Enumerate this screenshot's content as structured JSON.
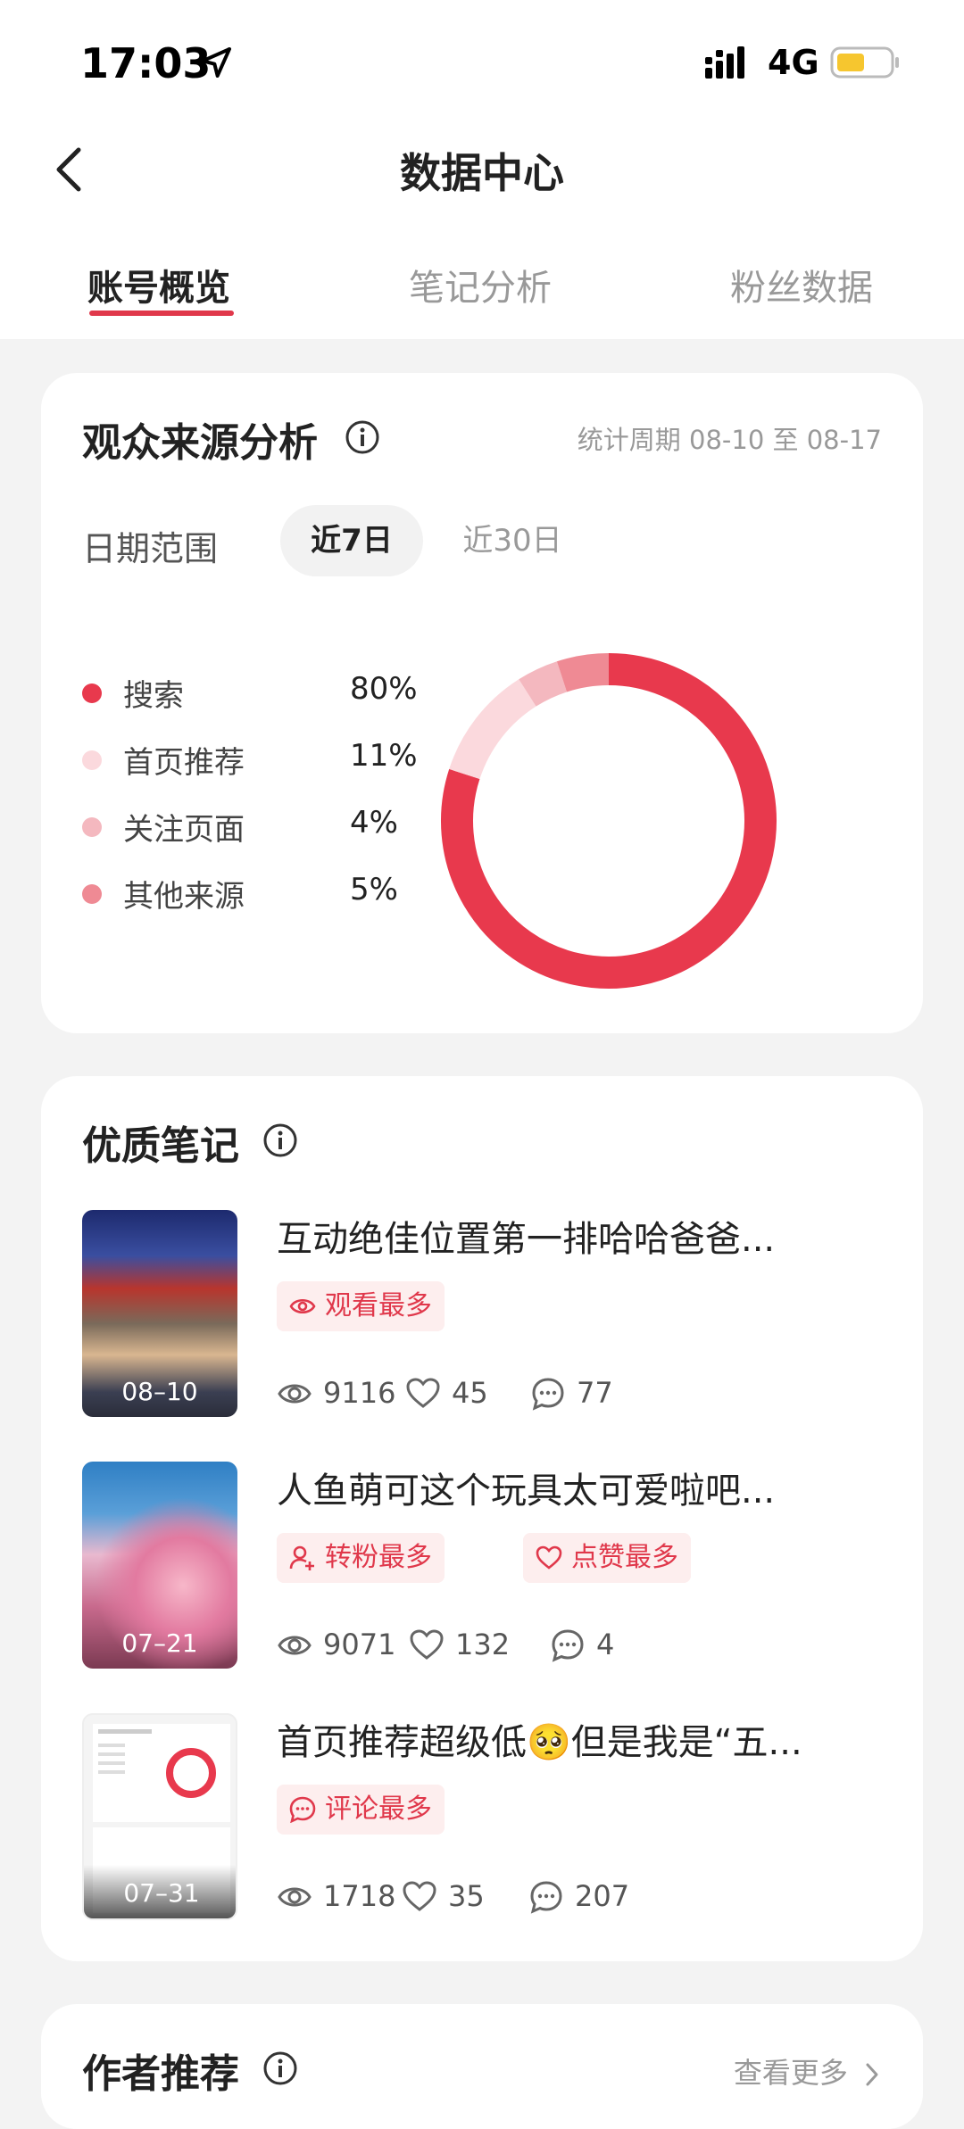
{
  "status_bar": {
    "time": "17:03",
    "network": "4G"
  },
  "nav": {
    "title": "数据中心"
  },
  "tabs": [
    {
      "label": "账号概览",
      "active": true
    },
    {
      "label": "笔记分析",
      "active": false
    },
    {
      "label": "粉丝数据",
      "active": false
    }
  ],
  "audience": {
    "title": "观众来源分析",
    "period": "统计周期 08-10 至 08-17",
    "range_label": "日期范围",
    "range_options": [
      "近7日",
      "近30日"
    ],
    "selected_range": "近7日",
    "legend": [
      {
        "label": "搜索",
        "value": "80%",
        "color": "#e8394d"
      },
      {
        "label": "首页推荐",
        "value": "11%",
        "color": "#fbd9dd"
      },
      {
        "label": "关注页面",
        "value": "4%",
        "color": "#f4b8bf"
      },
      {
        "label": "其他来源",
        "value": "5%",
        "color": "#ef8a94"
      }
    ]
  },
  "chart_data": {
    "type": "pie",
    "categories": [
      "搜索",
      "首页推荐",
      "关注页面",
      "其他来源"
    ],
    "values": [
      80,
      11,
      4,
      5
    ],
    "colors": [
      "#e8394d",
      "#fbd9dd",
      "#f4b8bf",
      "#ef8a94"
    ],
    "donut": true
  },
  "quality_notes": {
    "title": "优质笔记",
    "items": [
      {
        "title": "互动绝佳位置第一排哈哈爸爸...",
        "date": "08–10",
        "tags": [
          {
            "label": "观看最多",
            "icon": "eye-icon"
          }
        ],
        "views": "9116",
        "likes": "45",
        "comments": "77"
      },
      {
        "title": "人鱼萌可这个玩具太可爱啦吧...",
        "date": "07–21",
        "tags": [
          {
            "label": "转粉最多",
            "icon": "user-add-icon"
          },
          {
            "label": "点赞最多",
            "icon": "heart-icon"
          }
        ],
        "views": "9071",
        "likes": "132",
        "comments": "4"
      },
      {
        "title": "首页推荐超级低🥺但是我是“五...",
        "date": "07–31",
        "tags": [
          {
            "label": "评论最多",
            "icon": "comment-icon"
          }
        ],
        "views": "1718",
        "likes": "35",
        "comments": "207"
      }
    ]
  },
  "author_rec": {
    "title": "作者推荐",
    "more": "查看更多"
  }
}
